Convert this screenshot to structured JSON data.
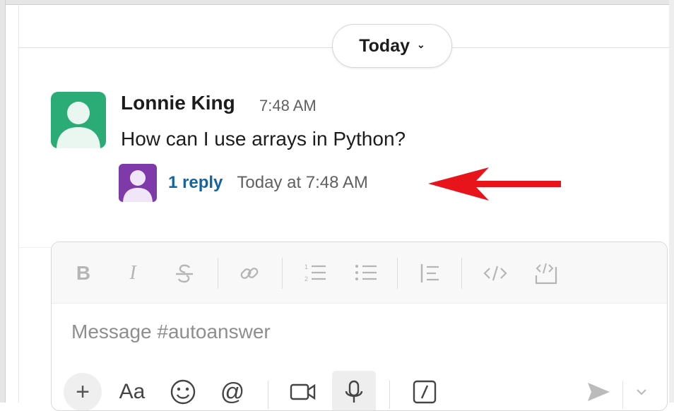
{
  "date_divider": {
    "label": "Today",
    "chevron": "⌄"
  },
  "message": {
    "author": "Lonnie King",
    "time": "7:48 AM",
    "text": "How can I use arrays in Python?",
    "avatar_color": "#2bac76"
  },
  "thread": {
    "reply_link": "1 reply",
    "reply_time": "Today at 7:48 AM",
    "reply_avatar_color": "#7d3aa8"
  },
  "annotation": {
    "arrow_color": "#e8141c"
  },
  "composer": {
    "placeholder": "Message #autoanswer",
    "format_toolbar": [
      "bold-icon",
      "italic-icon",
      "strikethrough-icon",
      "link-icon",
      "ordered-list-icon",
      "bulleted-list-icon",
      "blockquote-icon",
      "code-icon",
      "code-block-icon"
    ],
    "format_labels": {
      "bold": "B",
      "italic": "I"
    },
    "bottom_toolbar": [
      "plus-icon",
      "text-format-icon",
      "emoji-icon",
      "mention-icon",
      "video-icon",
      "microphone-icon",
      "slash-command-icon",
      "send-icon",
      "send-options-chevron-icon"
    ],
    "bottom_labels": {
      "plus": "+",
      "text_format": "Aa",
      "mention": "@"
    }
  }
}
